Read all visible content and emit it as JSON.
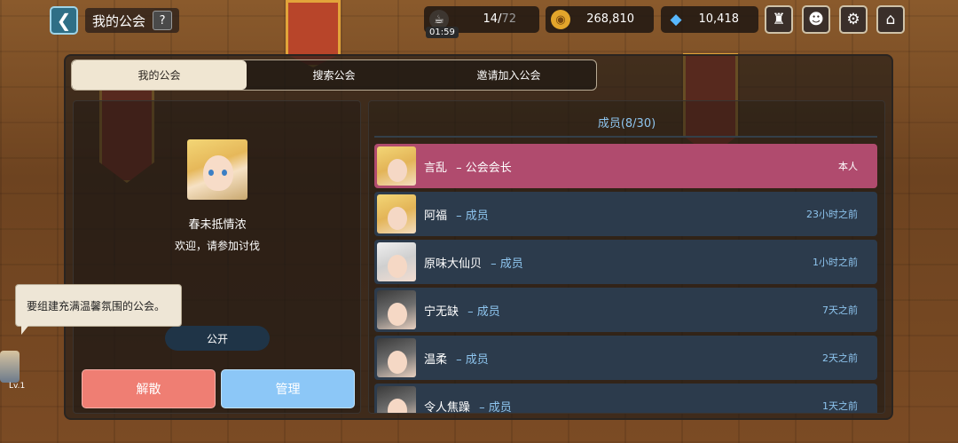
{
  "header": {
    "back_icon": "back-arrow-icon",
    "title": "我的公会",
    "help_label": "?"
  },
  "resources": {
    "stamina": {
      "value": "14/",
      "max": "72",
      "timer": "01:59",
      "icon": "coffee-cup-icon"
    },
    "gold": {
      "value": "268,810",
      "icon": "gold-coin-icon"
    },
    "diamond": {
      "value": "10,418",
      "icon": "diamond-icon"
    }
  },
  "toolbar_icons": [
    "guild-crest-icon",
    "avatar-mask-icon",
    "gear-icon",
    "home-icon"
  ],
  "tabs": [
    {
      "label": "我的公会",
      "active": true
    },
    {
      "label": "搜索公会",
      "active": false
    },
    {
      "label": "邀请加入公会",
      "active": false
    }
  ],
  "guild": {
    "name": "春未抵情浓",
    "message": "欢迎，请参加讨伐",
    "visibility_label": "公开"
  },
  "actions": {
    "disband_label": "解散",
    "manage_label": "管理"
  },
  "tooltip": {
    "text": "要组建充满温馨氛围的公会。"
  },
  "members": {
    "title": "成员(8/30)",
    "rows": [
      {
        "name": "言乱",
        "role": "公会会长",
        "status": "本人",
        "self": true,
        "avatar": "gold"
      },
      {
        "name": "阿福",
        "role": "成员",
        "status": "23小时之前",
        "self": false,
        "avatar": "gold"
      },
      {
        "name": "原味大仙贝",
        "role": "成员",
        "status": "1小时之前",
        "self": false,
        "avatar": "white"
      },
      {
        "name": "宁无缺",
        "role": "成员",
        "status": "7天之前",
        "self": false,
        "avatar": "dark"
      },
      {
        "name": "温柔",
        "role": "成员",
        "status": "2天之前",
        "self": false,
        "avatar": "dark"
      },
      {
        "name": "令人焦躁",
        "role": "成员",
        "status": "1天之前",
        "self": false,
        "avatar": "dark"
      }
    ]
  },
  "player": {
    "level_label": "Lv.1"
  },
  "colors": {
    "self_row": "#b04b6e",
    "member_row": "#2c3b4c",
    "accent_blue": "#8ec5ef",
    "disband": "#ef7e73",
    "manage": "#8cc7f7"
  }
}
